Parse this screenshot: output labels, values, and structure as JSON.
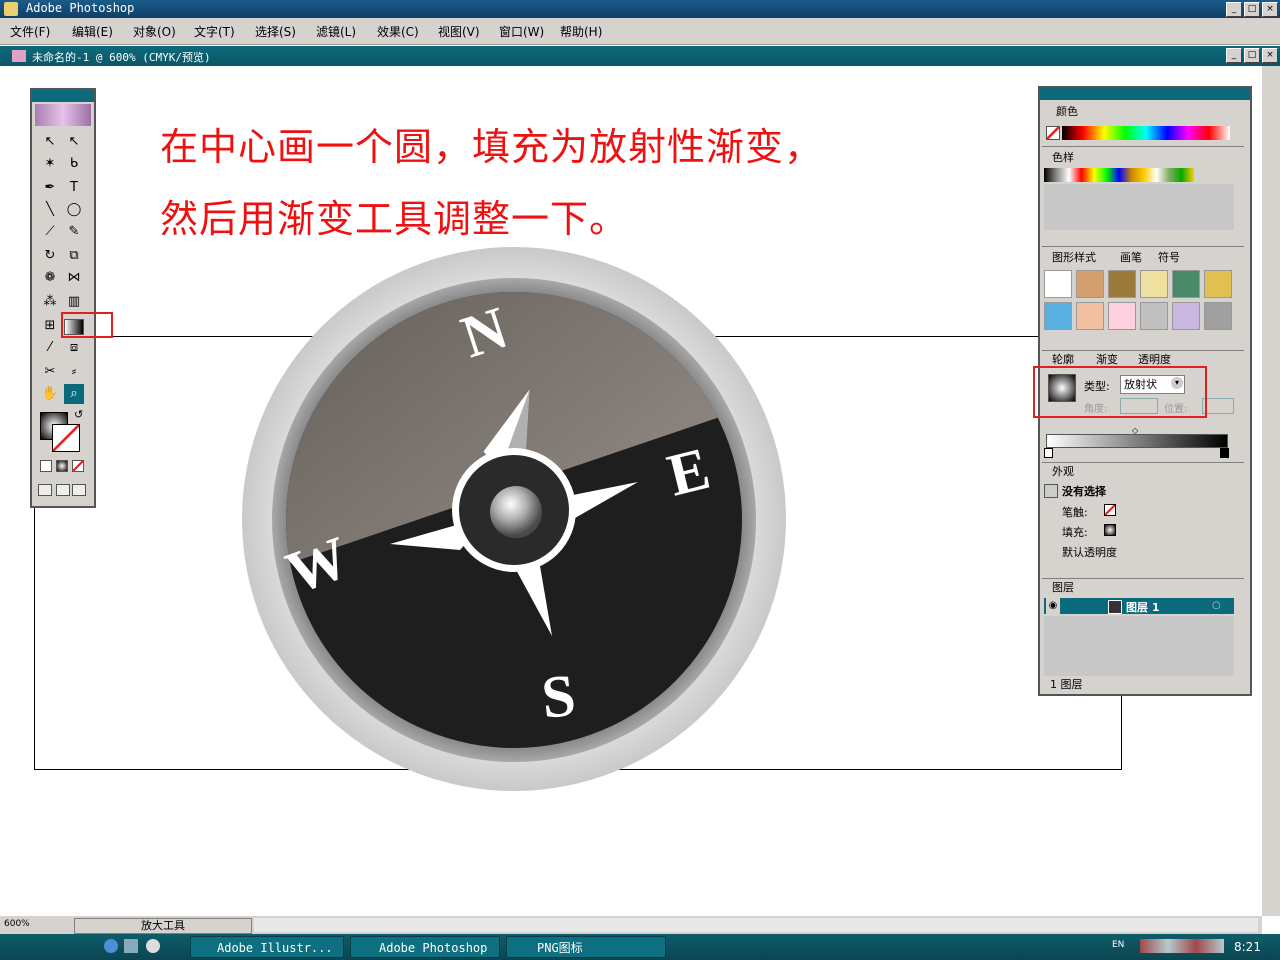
{
  "window": {
    "title": "Adobe Photoshop"
  },
  "menu": [
    "文件(F)",
    "编辑(E)",
    "对象(O)",
    "文字(T)",
    "选择(S)",
    "滤镜(L)",
    "效果(C)",
    "视图(V)",
    "窗口(W)",
    "帮助(H)"
  ],
  "document": {
    "title": "未命名的-1 @ 600% (CMYK/预览)"
  },
  "instructions": [
    "在中心画一个圆，填充为放射性渐变，",
    "然后用渐变工具调整一下。"
  ],
  "compass": {
    "north": "N",
    "east": "E",
    "south": "S",
    "west": "W"
  },
  "panels": {
    "color": {
      "tab": "颜色"
    },
    "swatches": {
      "tab": "色样"
    },
    "styles_tabs": [
      "图形样式",
      "画笔",
      "符号"
    ],
    "gradient_tabs": [
      "轮廓",
      "渐变",
      "透明度"
    ],
    "gradient": {
      "type_label": "类型:",
      "type_value": "放射状",
      "angle_label": "角度:",
      "position_label": "位置:"
    },
    "appearance": {
      "tab": "外观",
      "header": "没有选择",
      "stroke_label": "笔触:",
      "fill_label": "填充:",
      "opacity_label": "默认透明度"
    },
    "layers": {
      "tab": "图层",
      "layer_name": "图层 1",
      "footer": "1 图层"
    }
  },
  "status": {
    "zoom": "600%",
    "tool": "放大工具"
  },
  "taskbar": {
    "items": [
      "Adobe Illustr...",
      "Adobe Photoshop",
      "PNG图标"
    ],
    "lang": "EN",
    "time": "8:21"
  },
  "colors": {
    "highlight": "#e02020",
    "instruction_text": "#ee1111",
    "panel_teal": "#0b6b7c"
  }
}
